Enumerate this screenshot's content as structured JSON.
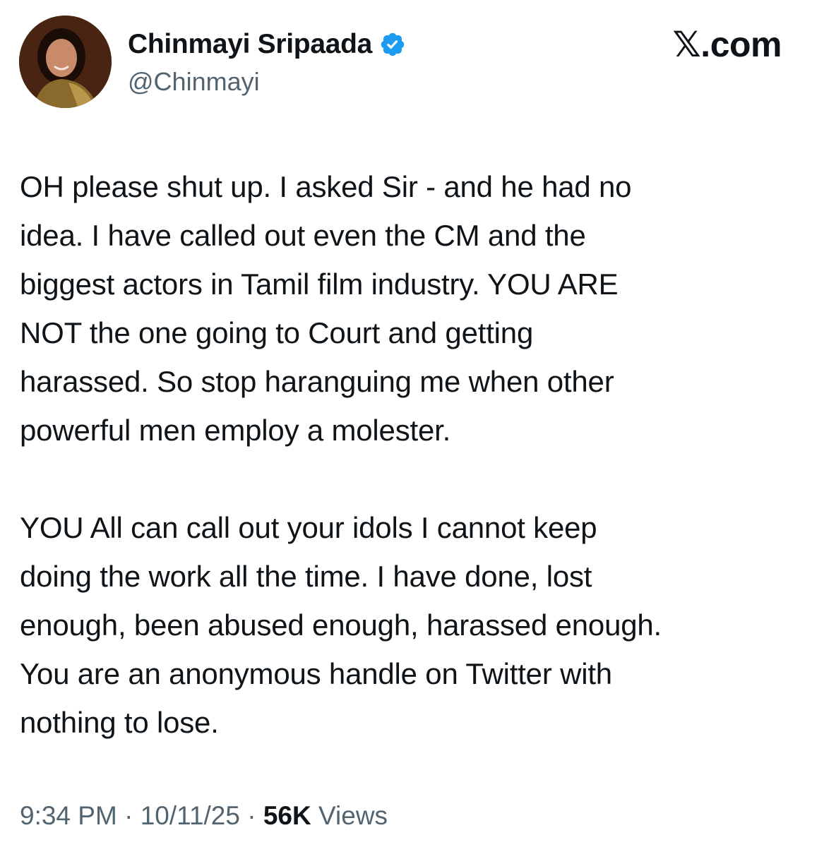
{
  "author": {
    "display_name": "Chinmayi Sripaada",
    "handle": "@Chinmayi",
    "verified": true,
    "verified_color": "#1d9bf0"
  },
  "brand": "𝕏.com",
  "post": {
    "paragraphs": [
      "OH please shut up. I asked Sir - and he had no\nidea. I have called out even the CM and the\nbiggest actors in Tamil film industry. YOU ARE\nNOT the one going to Court and getting\nharassed. So stop haranguing me when other\npowerful men employ a molester.",
      "YOU All can call out your idols I cannot keep\ndoing the work all the time. I have done, lost\nenough, been abused enough, harassed enough.\nYou are an anonymous handle on Twitter with\nnothing to lose."
    ]
  },
  "meta": {
    "time": "9:34 PM",
    "separator": " · ",
    "date": "10/11/25",
    "views_count": "56K",
    "views_label": " Views"
  },
  "colors": {
    "text": "#0f1419",
    "secondary": "#536471"
  }
}
